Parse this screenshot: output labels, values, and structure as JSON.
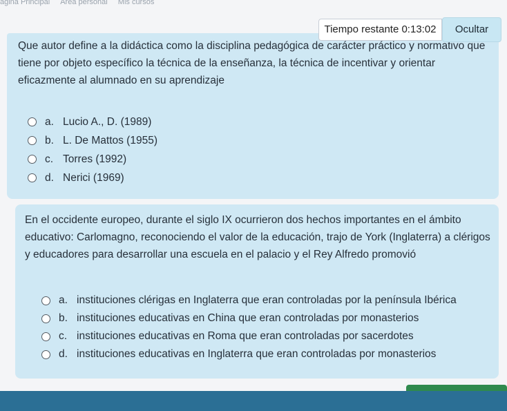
{
  "breadcrumb": {
    "items": [
      "ágina Principal",
      "Área personal",
      "Mis cursos"
    ]
  },
  "timer": {
    "label": "Tiempo restante",
    "value": "0:13:02"
  },
  "hide_button": {
    "label": "Ocultar"
  },
  "questions": [
    {
      "text": "Que autor define a la didáctica como la disciplina pedagógica de carácter práctico y normativo que tiene por objeto específico la técnica de la enseñanza, la técnica de incentivar y orientar eficazmente al alumnado en su aprendizaje",
      "options": [
        {
          "letter": "a.",
          "text": "Lucio A., D. (1989)"
        },
        {
          "letter": "b.",
          "text": "L. De Mattos (1955)"
        },
        {
          "letter": "c.",
          "text": "Torres (1992)"
        },
        {
          "letter": "d.",
          "text": "Nerici (1969)"
        }
      ]
    },
    {
      "text": "En el occidente europeo, durante el siglo IX ocurrieron dos hechos importantes en el ámbito educativo: Carlomagno, reconociendo el valor de la educación, trajo de York (Inglaterra) a clérigos y educadores para desarrollar una escuela en el palacio y el Rey Alfredo promovió",
      "options": [
        {
          "letter": "a.",
          "text": "instituciones clérigas en Inglaterra que eran controladas por la península Ibérica"
        },
        {
          "letter": "b.",
          "text": "instituciones educativas en China que eran controladas por monasterios"
        },
        {
          "letter": "c.",
          "text": "instituciones educativas en Roma que eran controladas por sacerdotes"
        },
        {
          "letter": "d.",
          "text": "instituciones educativas en Inglaterra que eran controladas por monasterios"
        }
      ]
    }
  ],
  "colors": {
    "card_bg": "#cfe8f4",
    "footer": "#2b6f95",
    "accent_button": "#2f8a4e"
  }
}
